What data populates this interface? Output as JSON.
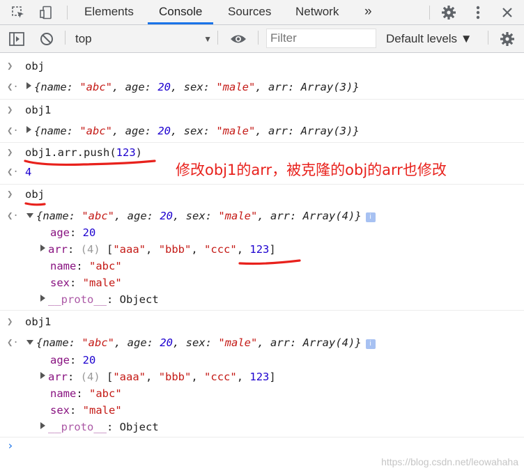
{
  "devtools": {
    "tabs": [
      {
        "label": "Elements"
      },
      {
        "label": "Console",
        "active": true
      },
      {
        "label": "Sources"
      },
      {
        "label": "Network"
      }
    ],
    "more_tabs": "»"
  },
  "toolbar": {
    "context": "top",
    "filter_placeholder": "Filter",
    "levels": "Default levels ▼"
  },
  "console": {
    "entries": [
      {
        "input": "obj"
      },
      {
        "output": {
          "name": "\"abc\"",
          "age": "20",
          "sex": "\"male\"",
          "arr": "Array(3)"
        }
      },
      {
        "input": "obj1"
      },
      {
        "output": {
          "name": "\"abc\"",
          "age": "20",
          "sex": "\"male\"",
          "arr": "Array(3)"
        }
      },
      {
        "input_prefix": "obj1.arr.push(",
        "input_num": "123",
        "input_suffix": ")"
      },
      {
        "result": "4"
      },
      {
        "input": "obj"
      },
      {
        "output_expanded": {
          "summary": {
            "name": "\"abc\"",
            "age": "20",
            "sex": "\"male\"",
            "arr": "Array(4)"
          },
          "age": "20",
          "arr_count": "(4)",
          "arr_items": [
            "\"aaa\"",
            "\"bbb\"",
            "\"ccc\"",
            "123"
          ],
          "name": "\"abc\"",
          "sex": "\"male\"",
          "proto": "Object"
        }
      },
      {
        "input": "obj1"
      },
      {
        "output_expanded": {
          "summary": {
            "name": "\"abc\"",
            "age": "20",
            "sex": "\"male\"",
            "arr": "Array(4)"
          },
          "age": "20",
          "arr_count": "(4)",
          "arr_items": [
            "\"aaa\"",
            "\"bbb\"",
            "\"ccc\"",
            "123"
          ],
          "name": "\"abc\"",
          "sex": "\"male\"",
          "proto": "Object"
        }
      }
    ],
    "prompt": "›"
  },
  "annotation": "修改obj1的arr，被克隆的obj的arr也修改",
  "watermark": "https://blog.csdn.net/leowahaha",
  "colors": {
    "annotation_red": "#e8211c",
    "string": "#c41a16",
    "number": "#1c00cf",
    "tab_active": "#1a73e8"
  }
}
